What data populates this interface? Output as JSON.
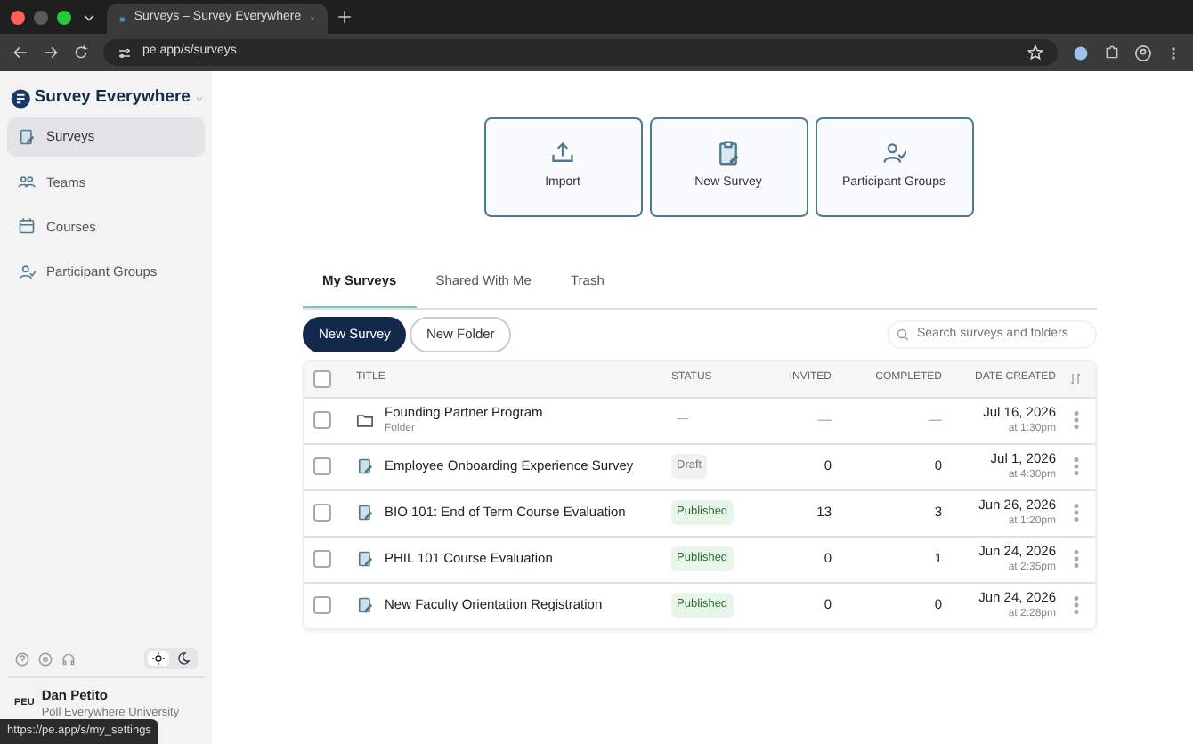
{
  "browser": {
    "tab_title": "Surveys – Survey Everywhere",
    "url": "pe.app/s/surveys",
    "status_url": "https://pe.app/s/my_settings"
  },
  "sidebar": {
    "brand": "Survey Everywhere",
    "items": [
      {
        "label": "Surveys",
        "selected": true
      },
      {
        "label": "Teams",
        "selected": false
      },
      {
        "label": "Courses",
        "selected": false
      },
      {
        "label": "Participant Groups",
        "selected": false
      }
    ],
    "theme_toggle": [
      {
        "selected": true
      },
      {
        "selected": false
      }
    ],
    "user": {
      "initials": "PEU",
      "name": "Dan Petito",
      "org": "Poll Everywhere University"
    }
  },
  "actions": [
    {
      "label": "Import"
    },
    {
      "label": "New Survey"
    },
    {
      "label": "Participant Groups"
    }
  ],
  "tabs": [
    {
      "label": "My Surveys",
      "selected": true
    },
    {
      "label": "Shared With Me",
      "selected": false
    },
    {
      "label": "Trash",
      "selected": false
    }
  ],
  "buttons": [
    {
      "label": "New Survey",
      "kind": "primary"
    },
    {
      "label": "New Folder",
      "kind": "outline"
    }
  ],
  "search": {
    "placeholder": "Search surveys and folders"
  },
  "table": {
    "select_all_checked": false,
    "columns": [
      "TITLE",
      "STATUS",
      "INVITED",
      "COMPLETED",
      "DATE CREATED"
    ],
    "rows": [
      {
        "kind": "folder",
        "checked": false,
        "title": "Founding Partner Program",
        "subtitle": "Folder",
        "status": {
          "text": "—",
          "kind": "none"
        },
        "invited": "—",
        "completed": "—",
        "date": "Jul 16, 2026",
        "time": "at 1:30pm"
      },
      {
        "kind": "survey",
        "checked": false,
        "title": "Employee Onboarding Experience Survey",
        "status": {
          "text": "Draft",
          "kind": "draft"
        },
        "invited": "0",
        "completed": "0",
        "date": "Jul 1, 2026",
        "time": "at 4:30pm"
      },
      {
        "kind": "survey",
        "checked": false,
        "title": "BIO 101: End of Term Course Evaluation",
        "status": {
          "text": "Published",
          "kind": "published"
        },
        "invited": "13",
        "completed": "3",
        "date": "Jun 26, 2026",
        "time": "at 1:20pm"
      },
      {
        "kind": "survey",
        "checked": false,
        "title": "PHIL 101 Course Evaluation",
        "status": {
          "text": "Published",
          "kind": "published"
        },
        "invited": "0",
        "completed": "1",
        "date": "Jun 24, 2026",
        "time": "at 2:35pm"
      },
      {
        "kind": "survey",
        "checked": false,
        "title": "New Faculty Orientation Registration",
        "status": {
          "text": "Published",
          "kind": "published"
        },
        "invited": "0",
        "completed": "0",
        "date": "Jun 24, 2026",
        "time": "at 2:28pm"
      }
    ]
  }
}
